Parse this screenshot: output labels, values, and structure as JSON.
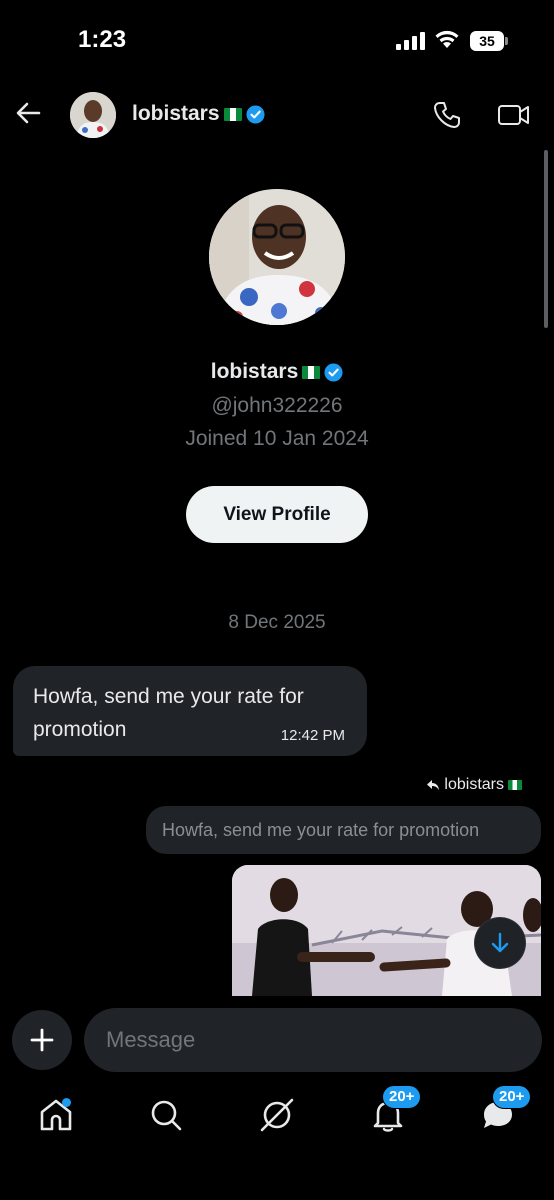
{
  "status_bar": {
    "time": "1:23",
    "battery": "35"
  },
  "header": {
    "name": "lobistars",
    "verified": true
  },
  "profile": {
    "name": "lobistars",
    "handle": "@john322226",
    "joined": "Joined 10 Jan 2024",
    "view_profile_label": "View Profile"
  },
  "conversation": {
    "date_separator": "8 Dec 2025",
    "messages": [
      {
        "direction": "incoming",
        "text": "Howfa, send me your rate for promotion",
        "time": "12:42 PM"
      }
    ],
    "reply": {
      "reply_to_name": "lobistars",
      "quoted_text": "Howfa, send me your rate for promotion"
    }
  },
  "composer": {
    "placeholder": "Message"
  },
  "bottom_nav": {
    "items": [
      {
        "name": "home",
        "icon": "home-icon"
      },
      {
        "name": "search",
        "icon": "search-icon"
      },
      {
        "name": "grok",
        "icon": "grok-icon"
      },
      {
        "name": "notifications",
        "icon": "bell-icon",
        "badge": "20+"
      },
      {
        "name": "messages",
        "icon": "messages-icon",
        "badge": "20+"
      }
    ]
  },
  "colors": {
    "accent": "#1d9bf0",
    "background": "#000000",
    "bubble": "#202327",
    "secondary_text": "#71767b"
  }
}
